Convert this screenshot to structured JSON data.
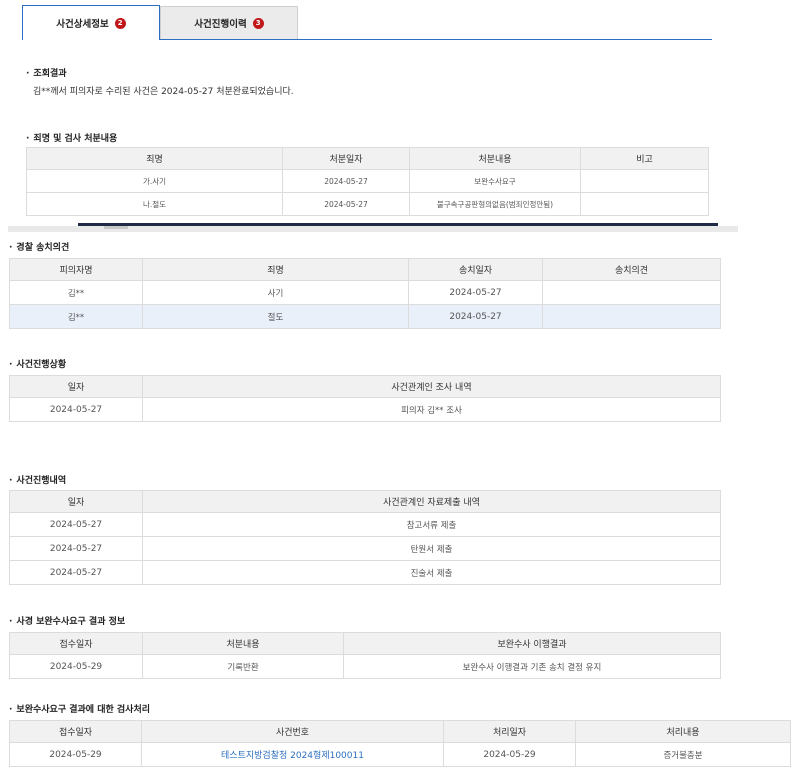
{
  "tabs": [
    {
      "label": "사건상세정보",
      "badge": "2"
    },
    {
      "label": "사건진행이력",
      "badge": "3"
    }
  ],
  "result": {
    "title": "조회결과",
    "text": "김**께서 피의자로 수리된 사건은 2024-05-27 처분완료되었습니다."
  },
  "disposition": {
    "title": "죄명 및 검사 처분내용",
    "headers": [
      "죄명",
      "처분일자",
      "처분내용",
      "비고"
    ],
    "rows": [
      [
        "가.사기",
        "2024-05-27",
        "보완수사요구",
        ""
      ],
      [
        "나.절도",
        "2024-05-27",
        "불구속구공판형의없음(범죄인정안됨)",
        ""
      ]
    ]
  },
  "police": {
    "title": "경찰 송치의견",
    "headers": [
      "피의자명",
      "죄명",
      "송치일자",
      "송치의견"
    ],
    "rows": [
      [
        "김**",
        "사기",
        "2024-05-27",
        ""
      ],
      [
        "김**",
        "절도",
        "2024-05-27",
        ""
      ]
    ]
  },
  "status": {
    "title": "사건진행상황",
    "headers": [
      "일자",
      "사건관계인 조사 내역"
    ],
    "rows": [
      [
        "2024-05-27",
        "피의자 김** 조사"
      ]
    ]
  },
  "history": {
    "title": "사건진행내역",
    "headers": [
      "일자",
      "사건관계인 자료제출 내역"
    ],
    "rows": [
      [
        "2024-05-27",
        "참고서류 제출"
      ],
      [
        "2024-05-27",
        "탄원서 제출"
      ],
      [
        "2024-05-27",
        "진술서 제출"
      ]
    ]
  },
  "supplement": {
    "title": "사경 보완수사요구 결과 정보",
    "headers": [
      "접수일자",
      "처분내용",
      "보완수사 이행결과"
    ],
    "rows": [
      [
        "2024-05-29",
        "기록반환",
        "보완수사 이행결과 기존 송치 결정 유지"
      ]
    ]
  },
  "prosecutor": {
    "title": "보완수사요구 결과에 대한 검사처리",
    "headers": [
      "접수일자",
      "사건번호",
      "처리일자",
      "처리내용"
    ],
    "rows": [
      [
        "2024-05-29",
        "테스트지방검찰청 2024형제100011",
        "2024-05-29",
        "증거불충분"
      ]
    ]
  },
  "colors": {
    "accent": "#2b6fc2",
    "badge": "#c0171b",
    "header_bg": "#f1f1f1",
    "highlight_row": "#e9f0fa"
  }
}
